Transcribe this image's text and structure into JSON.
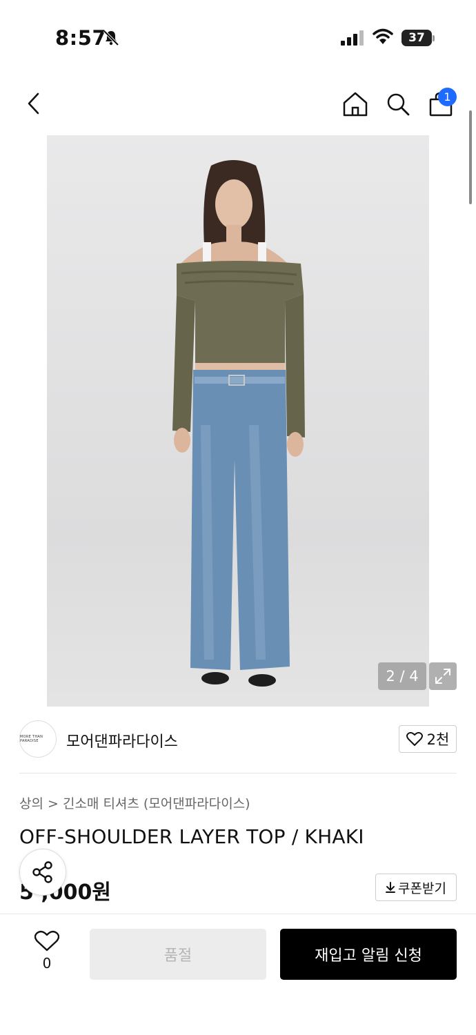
{
  "status_bar": {
    "time": "8:57",
    "battery": "37"
  },
  "header": {
    "cart_count": "1"
  },
  "gallery": {
    "counter": "2 / 4"
  },
  "brand": {
    "name": "모어댄파라다이스",
    "logo_text": "MORE THAN PARADISE",
    "likes": "2천"
  },
  "product": {
    "breadcrumb": "상의 > 긴소매 티셔츠 (모어댄파라다이스)",
    "title": "OFF-SHOULDER LAYER TOP / KHAKI",
    "price": "5 ,000원",
    "coupon_label": "쿠폰받기"
  },
  "bottom_bar": {
    "wish_count": "0",
    "soldout_label": "품절",
    "restock_label": "재입고 알림 신청"
  }
}
